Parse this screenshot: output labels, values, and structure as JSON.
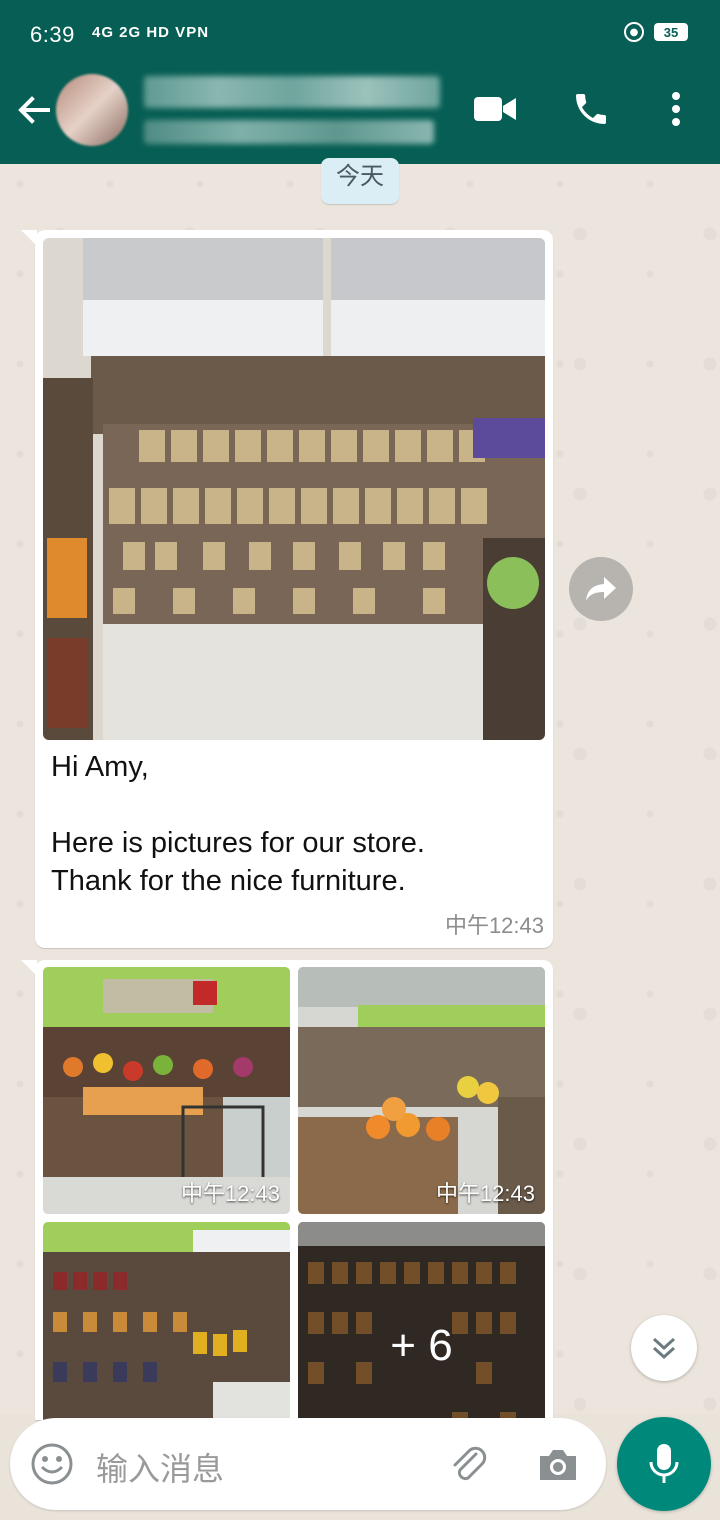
{
  "status_bar": {
    "time": "6:39",
    "network": "4G 2G HD VPN",
    "battery": "35"
  },
  "header": {
    "contact_name": "",
    "contact_status": ""
  },
  "chat": {
    "date_chip": "今天",
    "messages": [
      {
        "type": "image-with-caption",
        "text": "Hi Amy,\n\nHere is pictures for our store.\nThank for the nice furniture.",
        "time": "中午12:43"
      },
      {
        "type": "image-grid",
        "photos": [
          {
            "time": "中午12:43"
          },
          {
            "time": "中午12:43"
          },
          {
            "time": ""
          },
          {
            "overlay": "+ 6"
          }
        ]
      }
    ]
  },
  "composer": {
    "placeholder": "输入消息"
  },
  "colors": {
    "header": "#075e54",
    "accent": "#00897b",
    "chat_bg": "#ece5dd",
    "date_chip": "#dbeef5"
  }
}
